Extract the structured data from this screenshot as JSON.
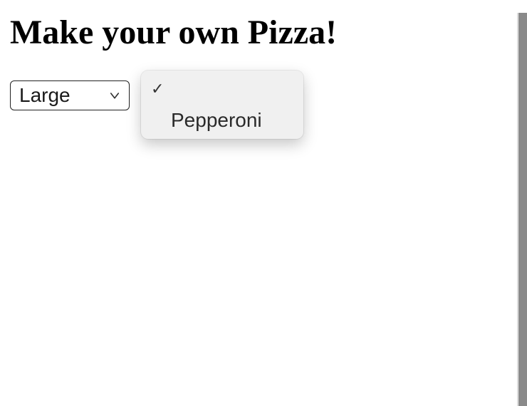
{
  "heading": "Make your own Pizza!",
  "size_select": {
    "selected": "Large"
  },
  "topping_dropdown": {
    "options": [
      {
        "label": "",
        "selected": true
      },
      {
        "label": "Pepperoni",
        "selected": false
      }
    ]
  },
  "icons": {
    "checkmark": "✓"
  }
}
